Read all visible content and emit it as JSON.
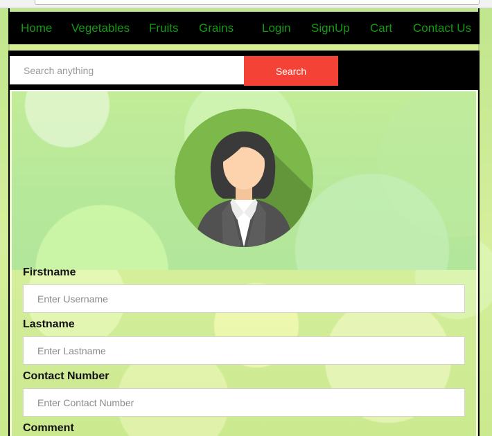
{
  "nav": {
    "items": [
      {
        "label": "Home"
      },
      {
        "label": "Vegetables"
      },
      {
        "label": "Fruits"
      },
      {
        "label": "Grains"
      },
      {
        "label": "Login"
      },
      {
        "label": "SignUp"
      },
      {
        "label": "Cart"
      },
      {
        "label": "Contact Us"
      }
    ]
  },
  "search": {
    "placeholder": "Search anything",
    "button_label": "Search"
  },
  "profile": {
    "avatar_icon": "female-user-avatar-icon"
  },
  "form": {
    "firstname": {
      "label": "Firstname",
      "placeholder": "Enter Username"
    },
    "lastname": {
      "label": "Lastname",
      "placeholder": "Enter Lastname"
    },
    "contact": {
      "label": "Contact Number",
      "placeholder": "Enter Contact Number"
    },
    "comment": {
      "label": "Comment"
    }
  },
  "colors": {
    "nav_bg": "#000000",
    "nav_link": "#159a15",
    "search_button": "#f44336",
    "page_bg": "#b9e48a"
  }
}
